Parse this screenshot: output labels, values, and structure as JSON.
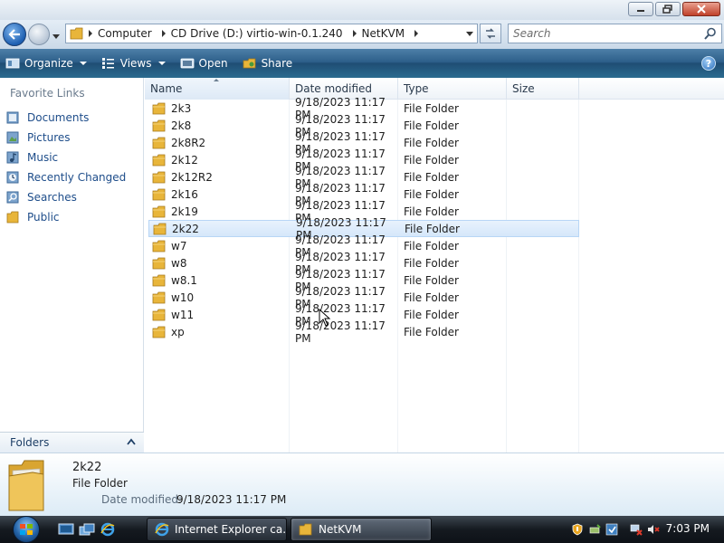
{
  "address": {
    "crumbs": [
      "Computer",
      "CD Drive (D:) virtio-win-0.1.240",
      "NetKVM"
    ]
  },
  "search": {
    "placeholder": "Search"
  },
  "toolbar": {
    "organize": "Organize",
    "views": "Views",
    "open": "Open",
    "share": "Share",
    "help": "?"
  },
  "nav": {
    "favorites_title": "Favorite Links",
    "items": [
      {
        "label": "Documents",
        "icon": "documents-icon"
      },
      {
        "label": "Pictures",
        "icon": "pictures-icon"
      },
      {
        "label": "Music",
        "icon": "music-icon"
      },
      {
        "label": "Recently Changed",
        "icon": "recently-changed-icon"
      },
      {
        "label": "Searches",
        "icon": "searches-icon"
      },
      {
        "label": "Public",
        "icon": "public-folder-icon"
      }
    ],
    "folders_label": "Folders"
  },
  "columns": {
    "name": "Name",
    "date": "Date modified",
    "type": "Type",
    "size": "Size"
  },
  "files": [
    {
      "name": "2k3",
      "date": "9/18/2023 11:17 PM",
      "type": "File Folder"
    },
    {
      "name": "2k8",
      "date": "9/18/2023 11:17 PM",
      "type": "File Folder"
    },
    {
      "name": "2k8R2",
      "date": "9/18/2023 11:17 PM",
      "type": "File Folder"
    },
    {
      "name": "2k12",
      "date": "9/18/2023 11:17 PM",
      "type": "File Folder"
    },
    {
      "name": "2k12R2",
      "date": "9/18/2023 11:17 PM",
      "type": "File Folder"
    },
    {
      "name": "2k16",
      "date": "9/18/2023 11:17 PM",
      "type": "File Folder"
    },
    {
      "name": "2k19",
      "date": "9/18/2023 11:17 PM",
      "type": "File Folder"
    },
    {
      "name": "2k22",
      "date": "9/18/2023 11:17 PM",
      "type": "File Folder"
    },
    {
      "name": "w7",
      "date": "9/18/2023 11:17 PM",
      "type": "File Folder"
    },
    {
      "name": "w8",
      "date": "9/18/2023 11:17 PM",
      "type": "File Folder"
    },
    {
      "name": "w8.1",
      "date": "9/18/2023 11:17 PM",
      "type": "File Folder"
    },
    {
      "name": "w10",
      "date": "9/18/2023 11:17 PM",
      "type": "File Folder"
    },
    {
      "name": "w11",
      "date": "9/18/2023 11:17 PM",
      "type": "File Folder"
    },
    {
      "name": "xp",
      "date": "9/18/2023 11:17 PM",
      "type": "File Folder"
    }
  ],
  "selected_index": 7,
  "details": {
    "name": "2k22",
    "type": "File Folder",
    "modified_label": "Date modified:",
    "modified_value": "9/18/2023 11:17 PM"
  },
  "taskbar": {
    "ie_label": "Internet Explorer ca...",
    "netkvm_label": "NetKVM",
    "clock": "7:03 PM"
  },
  "colors": {
    "toolbar": "#2d5f8a",
    "link": "#1e4d8a",
    "folder": "#e8b53a",
    "selection": "#d5e7fa"
  }
}
